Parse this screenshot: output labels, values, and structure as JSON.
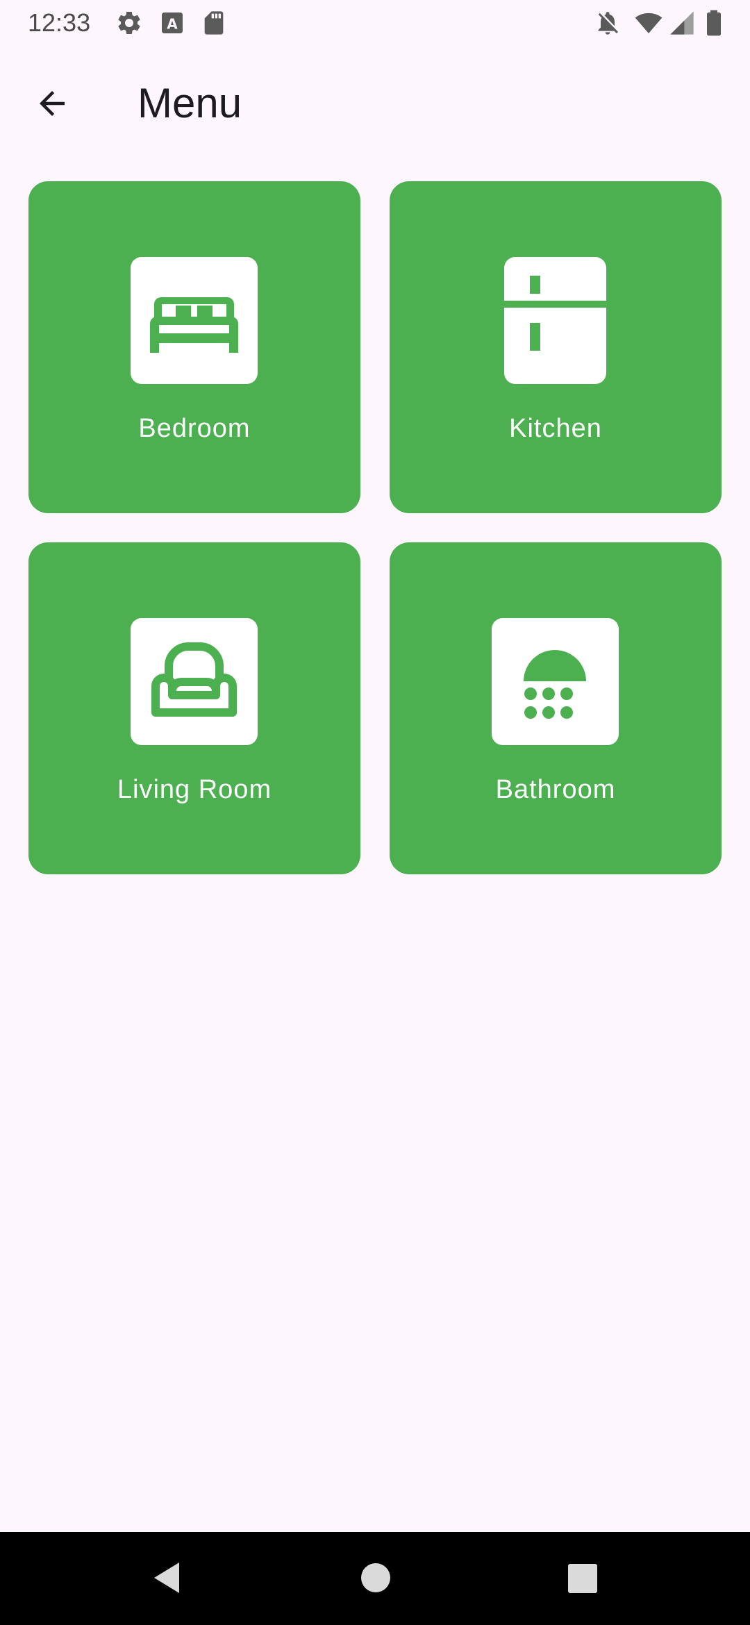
{
  "status_bar": {
    "time": "12:33",
    "left_icons": [
      "settings-icon",
      "a-box-icon",
      "sd-card-icon"
    ],
    "right_icons": [
      "notifications-off-icon",
      "wifi-icon",
      "signal-icon",
      "battery-icon"
    ]
  },
  "app_bar": {
    "back_icon": "arrow-back-icon",
    "title": "Menu"
  },
  "tiles": [
    {
      "label": "Bedroom",
      "icon": "bed-icon"
    },
    {
      "label": "Kitchen",
      "icon": "kitchen-icon"
    },
    {
      "label": "Living Room",
      "icon": "sofa-icon"
    },
    {
      "label": "Bathroom",
      "icon": "shower-icon"
    }
  ],
  "colors": {
    "tile_background": "#4CAF50",
    "page_background": "#FDF7FD",
    "icon_box": "#FFFFFF"
  },
  "nav_bar": {
    "buttons": [
      "back-triangle-icon",
      "home-circle-icon",
      "recents-square-icon"
    ]
  }
}
